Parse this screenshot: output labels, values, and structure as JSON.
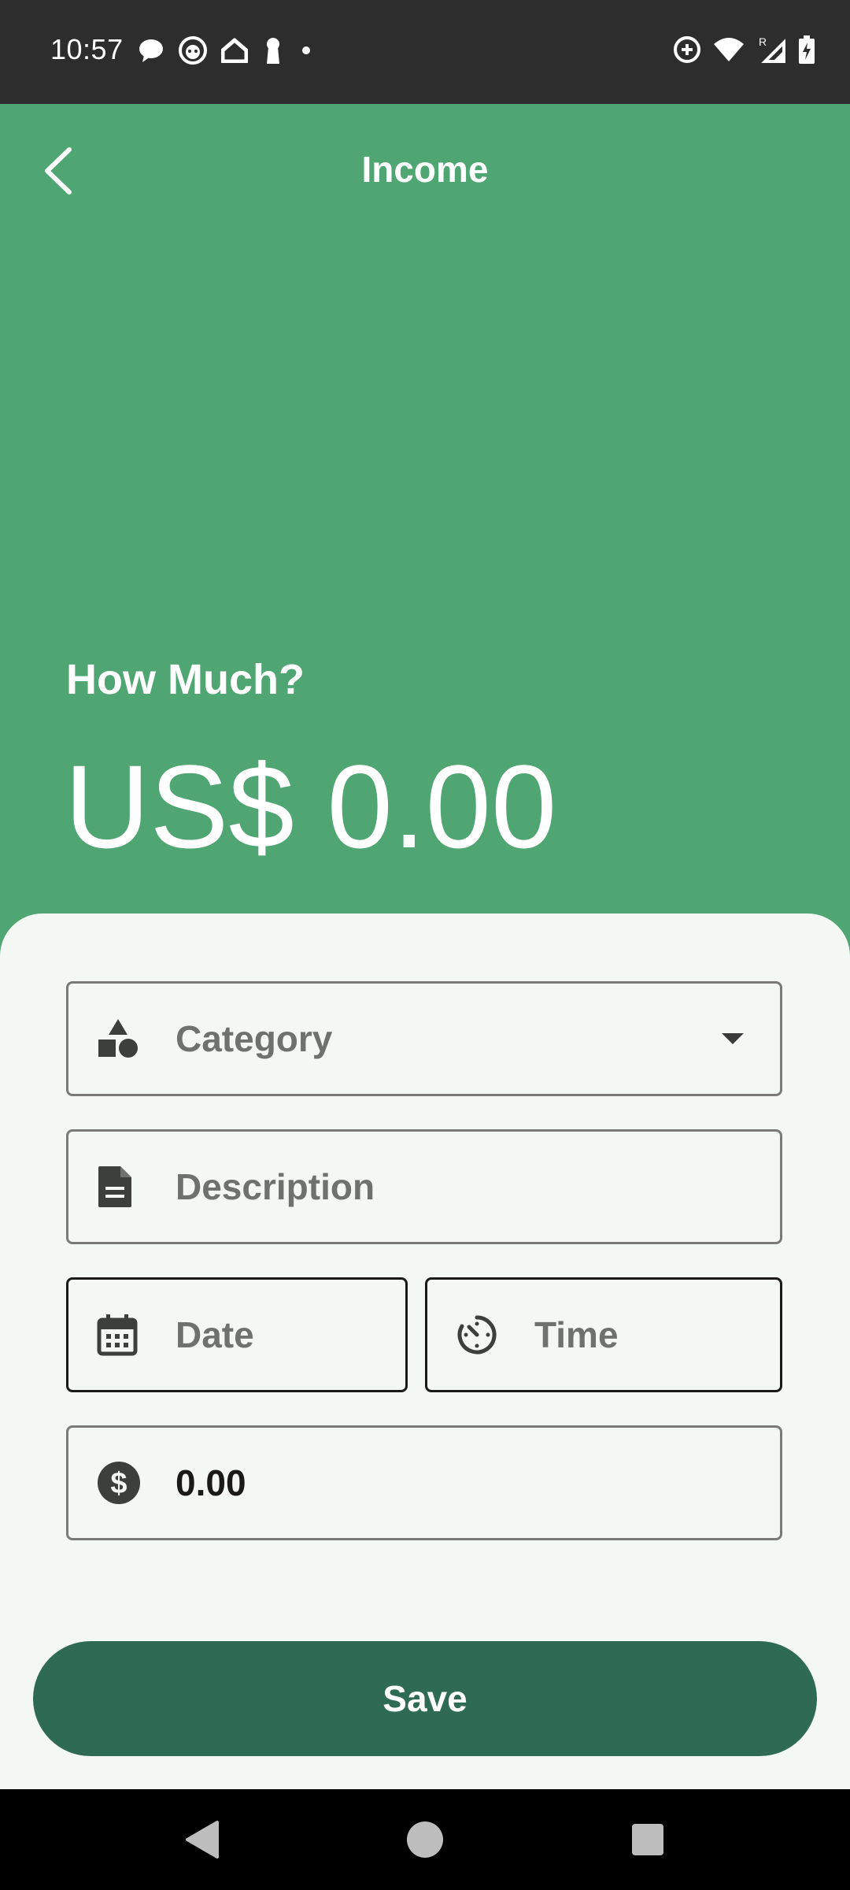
{
  "status_bar": {
    "time": "10:57",
    "left_icons": [
      "chat-bubble-icon",
      "cat-face-icon",
      "home-icon",
      "keyhole-icon",
      "dot-icon"
    ],
    "right_icons": [
      "data-saver-icon",
      "wifi-icon",
      "signal-roaming-icon",
      "battery-charging-icon"
    ],
    "roaming_label": "R"
  },
  "header": {
    "title": "Income",
    "prompt": "How Much?",
    "amount": "US$ 0.00"
  },
  "form": {
    "category_placeholder": "Category",
    "description_placeholder": "Description",
    "date_placeholder": "Date",
    "time_placeholder": "Time",
    "amount_value": "0.00"
  },
  "actions": {
    "save_label": "Save"
  },
  "colors": {
    "header_bg": "#4fa672",
    "sheet_bg": "#f4f8f4",
    "save_button": "#2f6a55",
    "status_bar_bg": "#2d2d2d"
  }
}
